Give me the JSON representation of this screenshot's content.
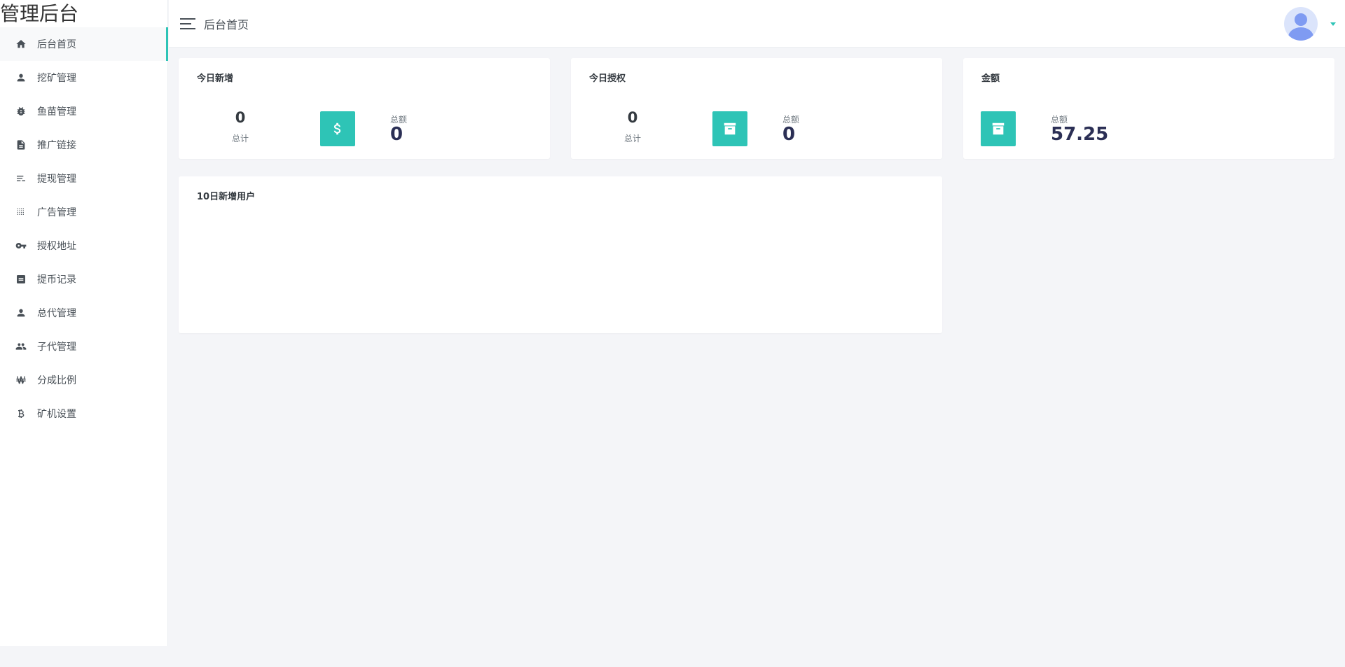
{
  "app": {
    "logo_text": "管理后台"
  },
  "header": {
    "title": "后台首页"
  },
  "sidebar": {
    "items": [
      {
        "label": "后台首页",
        "icon": "home-icon",
        "active": true
      },
      {
        "label": "挖矿管理",
        "icon": "user-icon"
      },
      {
        "label": "鱼苗管理",
        "icon": "bug-icon"
      },
      {
        "label": "推广链接",
        "icon": "document-icon"
      },
      {
        "label": "提现管理",
        "icon": "list-icon"
      },
      {
        "label": "广告管理",
        "icon": "grid-icon"
      },
      {
        "label": "授权地址",
        "icon": "key-icon"
      },
      {
        "label": "提币记录",
        "icon": "book-icon"
      },
      {
        "label": "总代管理",
        "icon": "user-icon"
      },
      {
        "label": "子代管理",
        "icon": "users-icon"
      },
      {
        "label": "分成比例",
        "icon": "won-icon"
      },
      {
        "label": "矿机设置",
        "icon": "bitcoin-icon"
      }
    ]
  },
  "cards": {
    "today_new": {
      "title": "今日新增",
      "count": "0",
      "count_label": "总计",
      "amount_label": "总额",
      "amount": "0",
      "icon": "dollar-icon"
    },
    "today_auth": {
      "title": "今日授权",
      "count": "0",
      "count_label": "总计",
      "amount_label": "总额",
      "amount": "0",
      "icon": "archive-icon"
    },
    "amount": {
      "title": "金额",
      "amount_label": "总额",
      "amount": "57.25",
      "icon": "archive-icon"
    },
    "ten_day_users": {
      "title": "10日新增用户"
    }
  },
  "colors": {
    "accent": "#2ec4b6",
    "value_text": "#2b2f55",
    "page_bg": "#f4f5f8"
  }
}
